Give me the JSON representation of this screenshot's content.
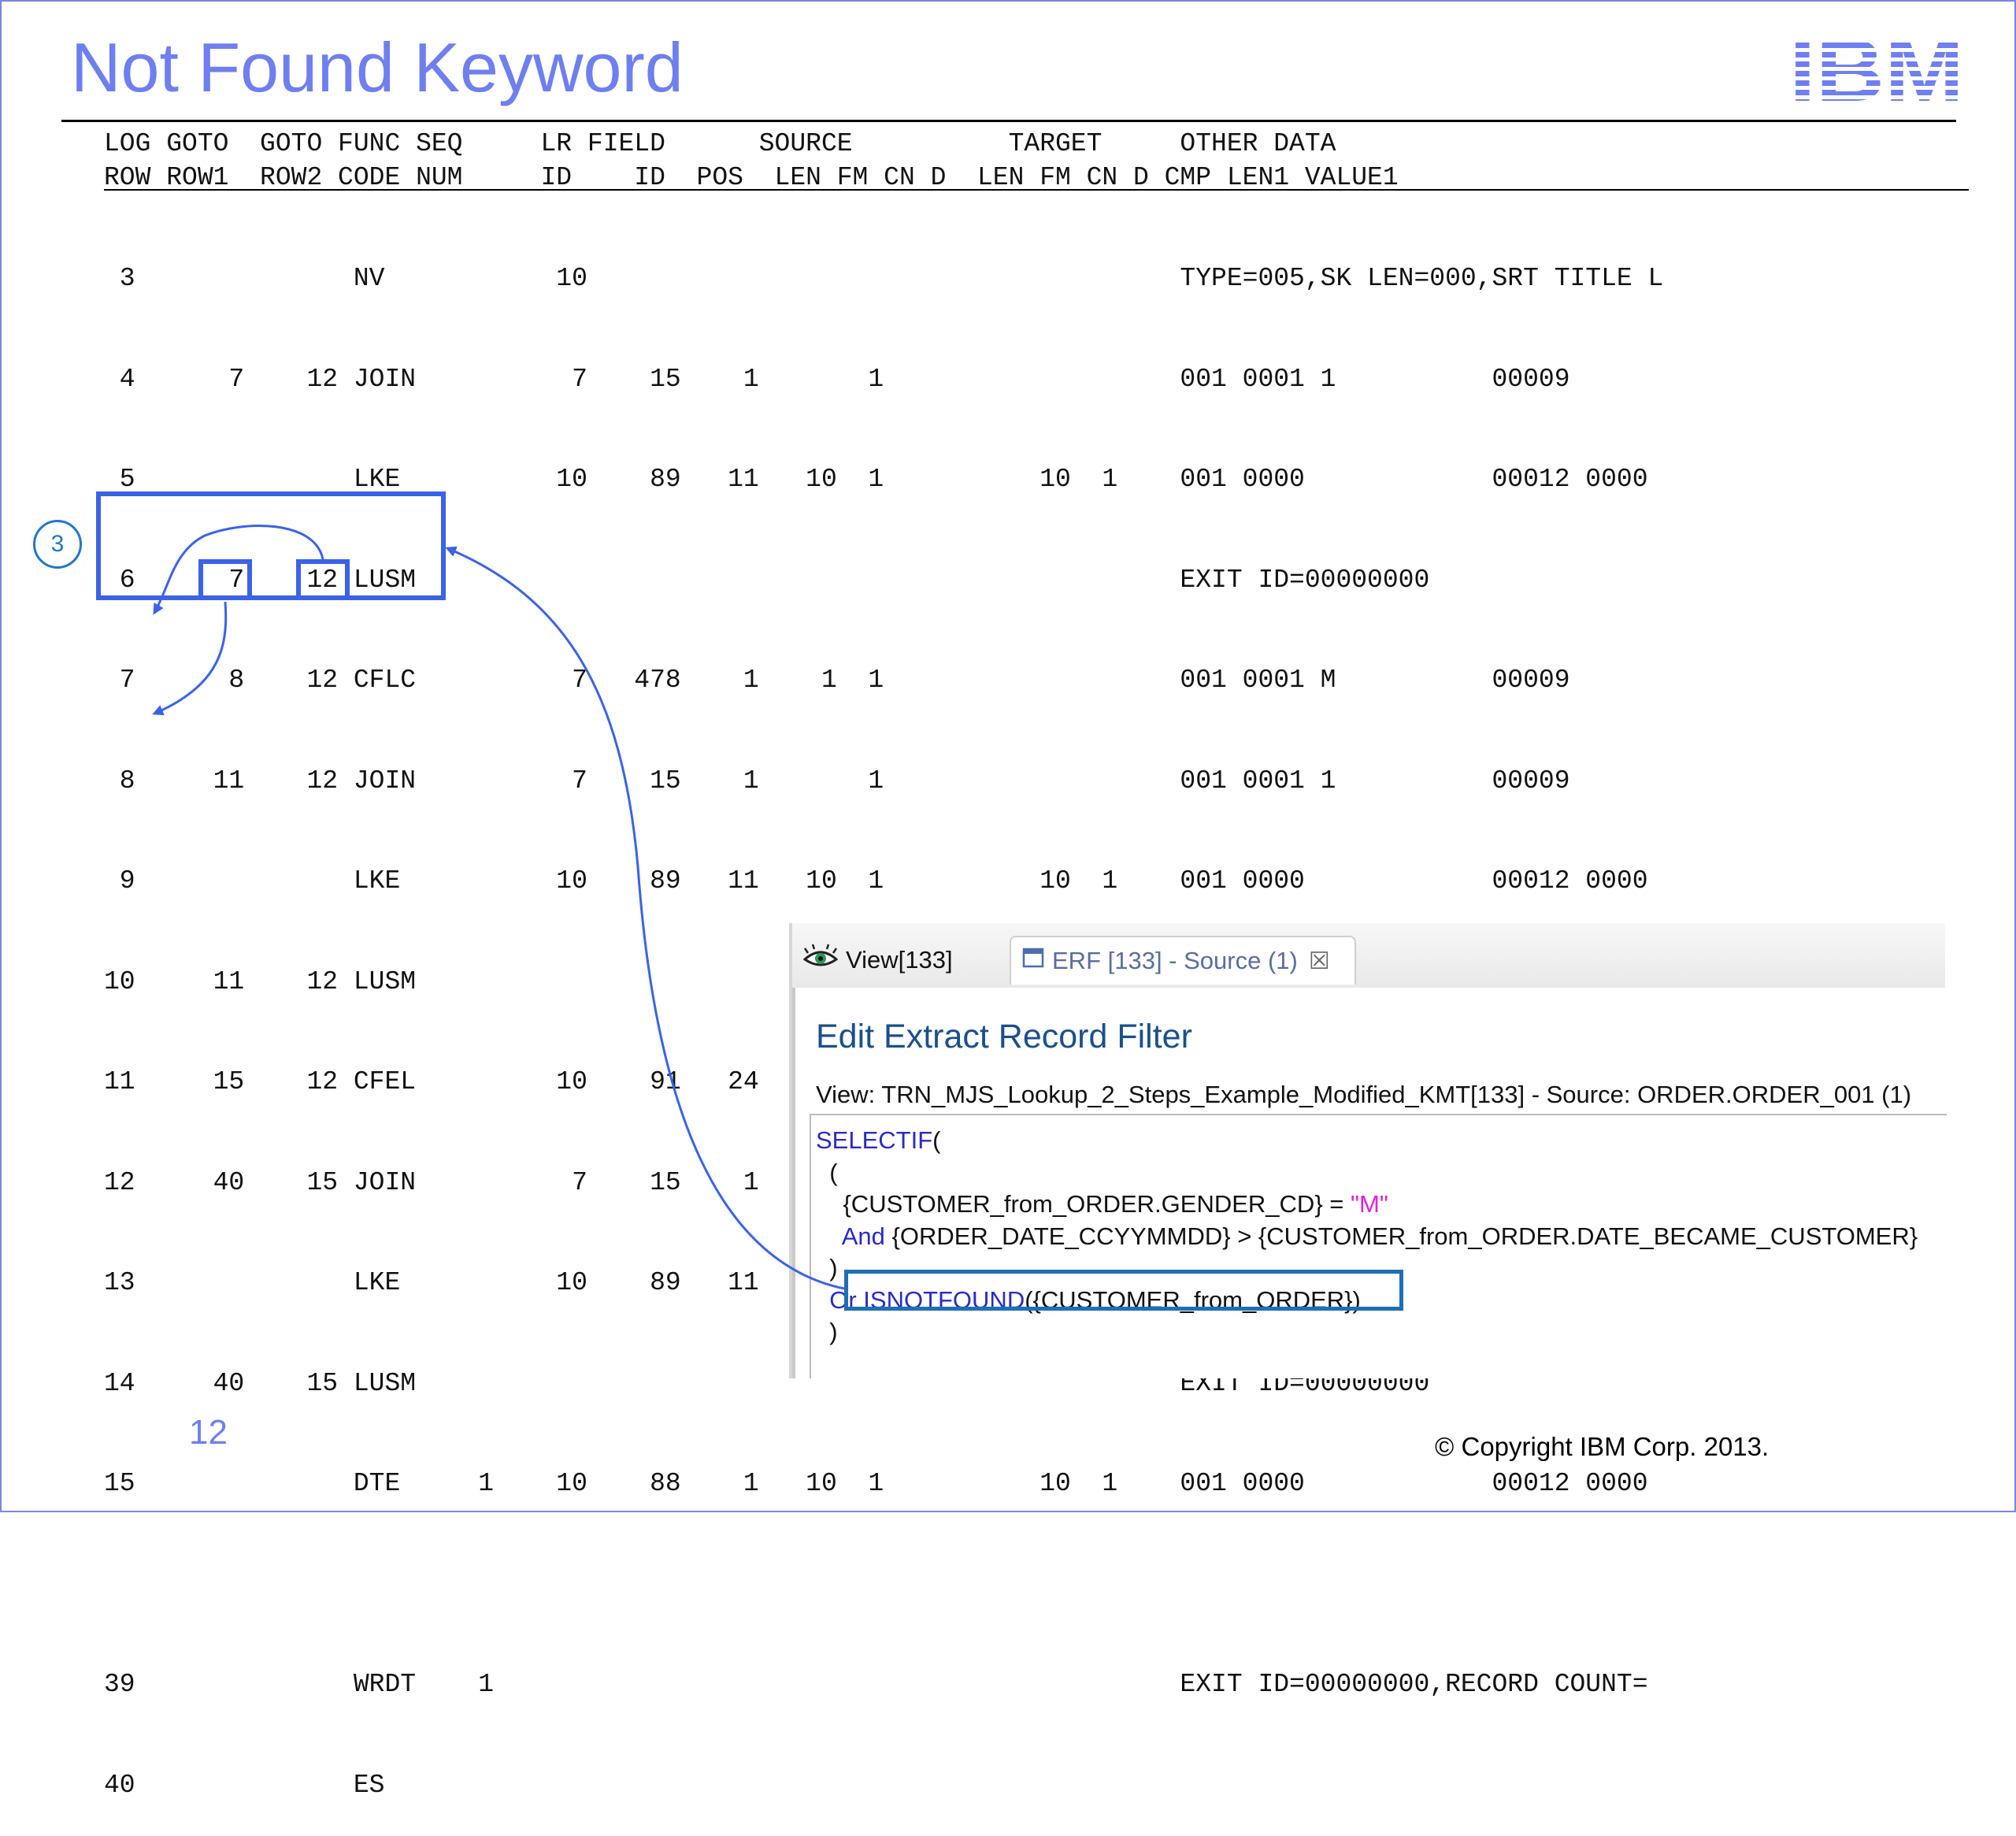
{
  "slide": {
    "title": "Not Found Keyword",
    "page_number": "12",
    "copyright": "© Copyright IBM Corp. 2013.",
    "logo_text": "IBM"
  },
  "listing": {
    "header_line1": "LOG GOTO  GOTO FUNC SEQ     LR FIELD      SOURCE          TARGET     OTHER DATA",
    "header_line2": "ROW ROW1  ROW2 CODE NUM     ID    ID  POS  LEN FM CN D  LEN FM CN D CMP LEN1 VALUE1",
    "rows": [
      " 3              NV           10                                      TYPE=005,SK LEN=000,SRT TITLE L",
      " 4      7    12 JOIN          7    15    1       1                   001 0001 1          00009",
      " 5              LKE          10    89   11   10  1          10  1    001 0000            00012 0000",
      " 6      7    12 LUSM                                                 EXIT ID=00000000",
      " 7      8    12 CFLC          7   478    1    1  1                   001 0001 M          00009",
      " 8     11    12 JOIN          7    15    1       1                   001 0001 1          00009",
      " 9              LKE          10    89   11   10  1          10  1    001 0000            00012 0000",
      "10     11    12 LUSM                                                 EXIT ID=00000000",
      "11     15    12 CFEL         10    91   24    8  1  3        8  1  3 003 0000            00012 0000",
      "12     40    15 JOIN          7    15    1       1                   001 0001 1          00009",
      "13              LKE          10    89   11   10  1          10  1    001 0000            00012 0000",
      "14     40    15 LUSM                                                 EXIT ID=00000000",
      "15              DTE     1    10    88    1   10  1          10  1    001 0000            00012 0000",
      "",
      "39              WRDT    1                                            EXIT ID=00000000,RECORD COUNT=",
      "40              ES"
    ]
  },
  "callout": {
    "step_number": "3"
  },
  "editor": {
    "tabs": [
      {
        "label": "View[133]",
        "icon": "eye-icon"
      },
      {
        "label": "ERF [133] - Source (1)",
        "icon": "window-icon",
        "close": "☒"
      }
    ],
    "heading": "Edit Extract Record Filter",
    "view_line": "View: TRN_MJS_Lookup_2_Steps_Example_Modified_KMT[133] - Source: ORDER.ORDER_001 (1)",
    "code": {
      "l1_kw": "SELECTIF",
      "l1_rest": "(",
      "l2": "  (",
      "l3_a": "    {CUSTOMER_from_ORDER.GENDER_CD} = ",
      "l3_str": "\"M\"",
      "l4_kw": "    And",
      "l4_rest": " {ORDER_DATE_CCYYMMDD} > {CUSTOMER_from_ORDER.DATE_BECAME_CUSTOMER}",
      "l5": "  )",
      "l6_kw": "  Or ISNOTFOUND",
      "l6_rest": "({CUSTOMER_from_ORDER})",
      "l7": "  )"
    }
  },
  "colors": {
    "title": "#6f7ff0",
    "box": "#3b63e6",
    "highlight": "#1f6fb6",
    "keyword": "#2a2ac8",
    "string": "#e020d0"
  }
}
